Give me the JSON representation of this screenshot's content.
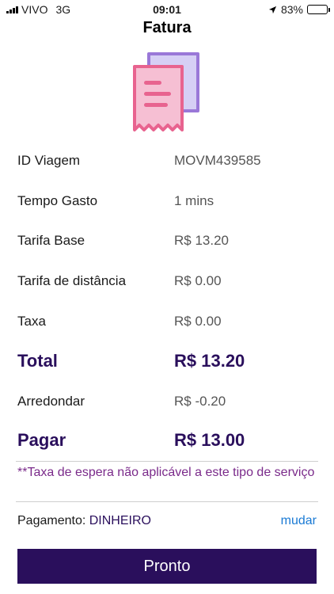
{
  "status_bar": {
    "carrier": "VIVO",
    "network": "3G",
    "time": "09:01",
    "battery": "83%",
    "battery_level": 0.83
  },
  "header": {
    "title": "Fatura"
  },
  "invoice": {
    "rows": [
      {
        "label": "ID Viagem",
        "value": "MOVM439585"
      },
      {
        "label": "Tempo Gasto",
        "value": "1 mins"
      },
      {
        "label": "Tarifa Base",
        "value": "R$ 13.20"
      },
      {
        "label": "Tarifa de distância",
        "value": "R$ 0.00"
      },
      {
        "label": "Taxa",
        "value": "R$ 0.00"
      },
      {
        "label": "Total",
        "value": "R$ 13.20"
      },
      {
        "label": "Arredondar",
        "value": "R$ -0.20"
      },
      {
        "label": "Pagar",
        "value": "R$ 13.00"
      }
    ]
  },
  "note": "**Taxa de espera não aplicável a este tipo de serviço",
  "payment": {
    "label": "Pagamento:",
    "method": "DINHEIRO",
    "change_link": "mudar"
  },
  "actions": {
    "done_label": "Pronto"
  },
  "colors": {
    "accent": "#2a0f5c",
    "link": "#1a7ad4",
    "note": "#7a2a8a",
    "icon_pink": "#e8638f",
    "icon_purple": "#9a78d8"
  },
  "icons": {
    "status_location": "location-arrow-icon",
    "receipt": "receipt-icon"
  }
}
